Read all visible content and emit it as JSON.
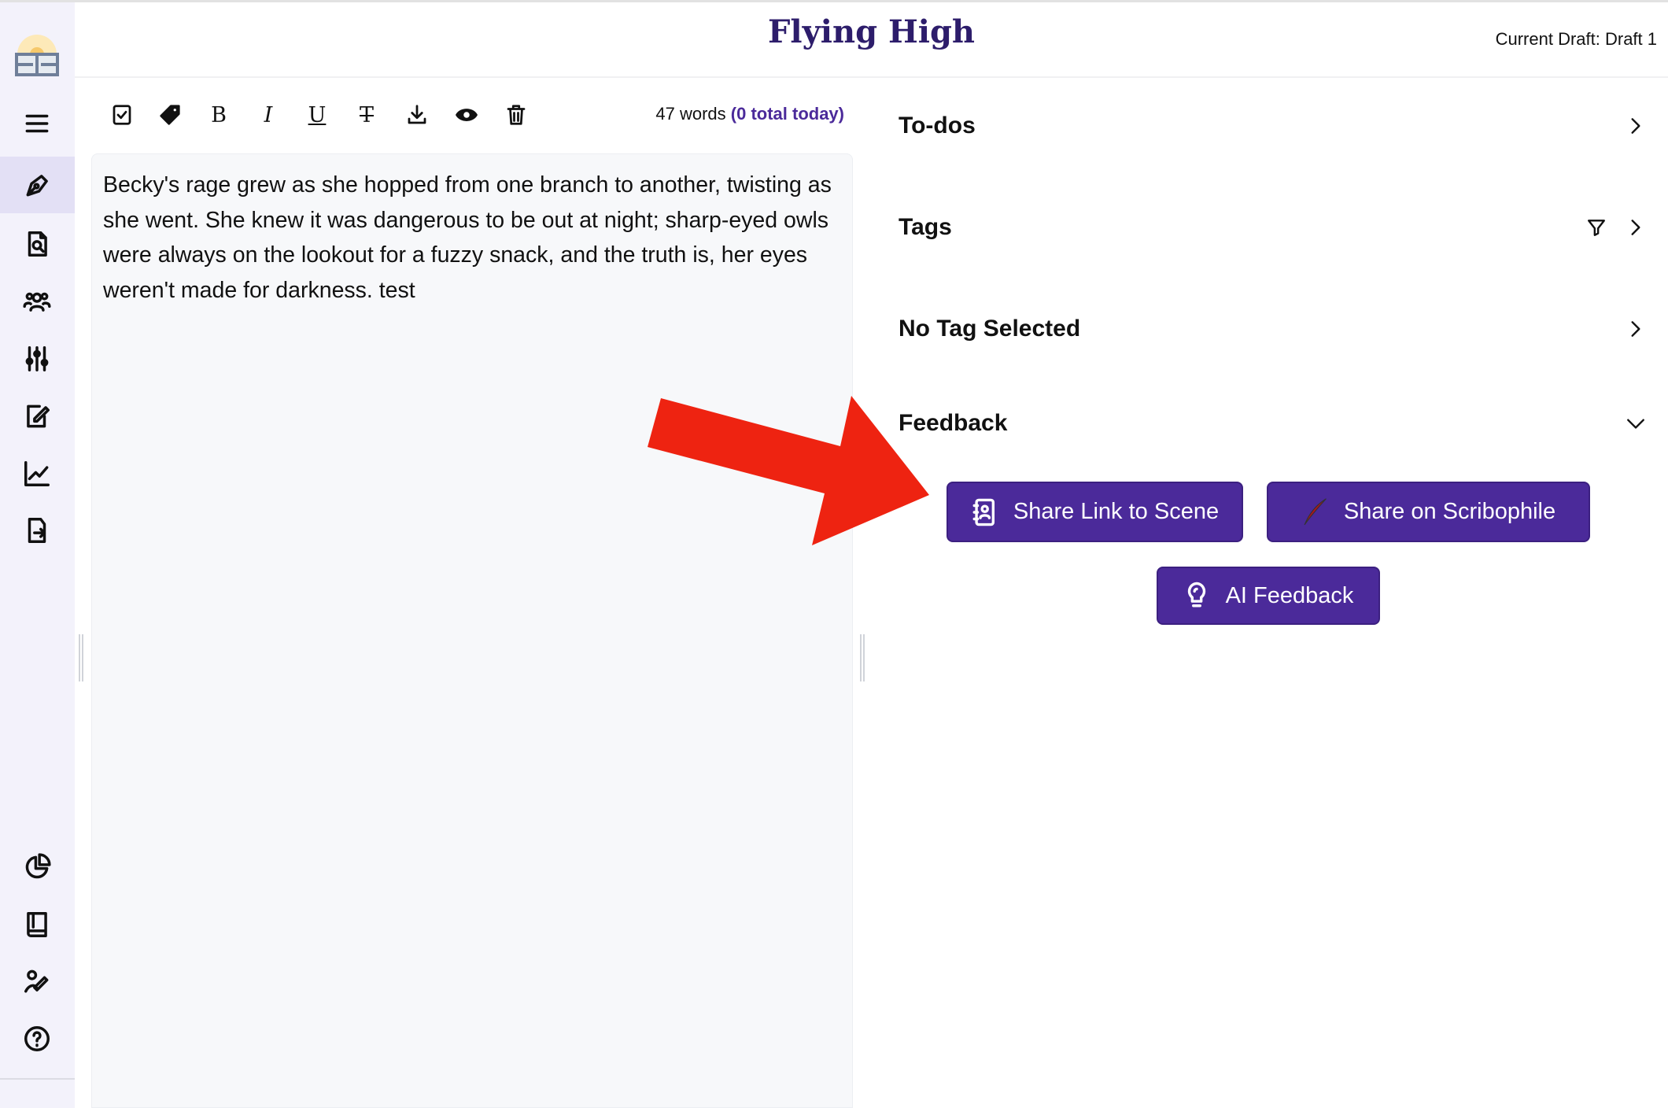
{
  "header": {
    "title": "Flying High",
    "current_draft": "Current Draft: Draft 1"
  },
  "sidebar": {
    "items": [
      {
        "icon": "menu-icon"
      },
      {
        "icon": "pen-icon",
        "active": true
      },
      {
        "icon": "search-document-icon"
      },
      {
        "icon": "characters-icon"
      },
      {
        "icon": "sliders-icon"
      },
      {
        "icon": "edit-notes-icon"
      },
      {
        "icon": "chart-icon"
      },
      {
        "icon": "export-icon"
      },
      {
        "icon": "pie-chart-icon"
      },
      {
        "icon": "book-icon"
      },
      {
        "icon": "signature-icon"
      },
      {
        "icon": "help-icon"
      }
    ]
  },
  "toolbar": {
    "icons": [
      "todo-checkbox-icon",
      "tag-icon",
      "bold-icon",
      "italic-icon",
      "underline-icon",
      "clear-format-icon",
      "download-icon",
      "preview-eye-icon",
      "trash-icon"
    ],
    "bold": "B",
    "italic": "I",
    "underline": "U",
    "clear": "T",
    "word_count": "47 words",
    "today": "(0 total today)"
  },
  "editor": {
    "text": "Becky's rage grew as she hopped from one branch to another, twisting as she went. She knew it was dangerous to be out at night; sharp-eyed owls were always on the lookout for a fuzzy snack, and the truth is, her eyes weren't made for darkness. test"
  },
  "panel": {
    "sections": [
      {
        "label": "To-dos"
      },
      {
        "label": "Tags"
      },
      {
        "label": "No Tag Selected"
      },
      {
        "label": "Feedback",
        "expanded": true
      }
    ],
    "buttons": {
      "share_link": "Share Link to Scene",
      "scribophile": "Share on Scribophile",
      "ai": "AI Feedback"
    }
  },
  "colors": {
    "accent": "#4b2a9a",
    "title": "#2d1d6b",
    "arrow": "#ee2311"
  }
}
